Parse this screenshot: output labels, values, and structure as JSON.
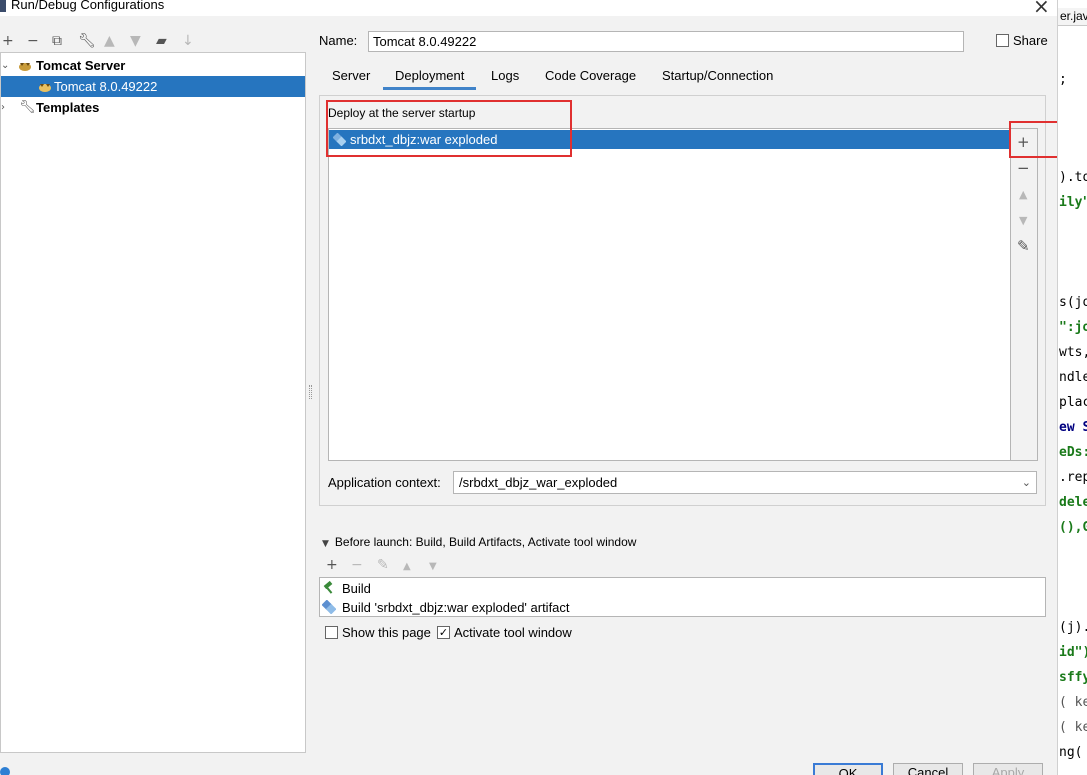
{
  "window": {
    "title": "Run/Debug Configurations"
  },
  "left_toolbar": {
    "icons": [
      "add-icon",
      "remove-icon",
      "copy-icon",
      "wrench-icon",
      "move-up-icon",
      "move-down-icon",
      "folder-icon",
      "sort-icon"
    ]
  },
  "tree": {
    "group_label": "Tomcat Server",
    "child_label": "Tomcat 8.0.49222",
    "templates_label": "Templates"
  },
  "name_field": {
    "label": "Name:",
    "value": "Tomcat 8.0.49222"
  },
  "share": {
    "label": "Share",
    "checked": false
  },
  "tabs": [
    {
      "label": "Server",
      "active": false
    },
    {
      "label": "Deployment",
      "active": true
    },
    {
      "label": "Logs",
      "active": false
    },
    {
      "label": "Code Coverage",
      "active": false
    },
    {
      "label": "Startup/Connection",
      "active": false
    }
  ],
  "deployment": {
    "title": "Deploy at the server startup",
    "items": [
      "srbdxt_dbjz:war exploded"
    ],
    "side_icons": [
      "add-icon",
      "remove-icon",
      "move-up-icon",
      "move-down-icon",
      "edit-icon"
    ]
  },
  "app_context": {
    "label": "Application context:",
    "value": "/srbdxt_dbjz_war_exploded"
  },
  "before_launch": {
    "title": "Before launch: Build, Build Artifacts, Activate tool window",
    "items": [
      "Build",
      "Build 'srbdxt_dbjz:war exploded' artifact"
    ]
  },
  "options": {
    "show_page": {
      "label": "Show this page",
      "checked": false
    },
    "activate_window": {
      "label": "Activate tool window",
      "checked": true
    }
  },
  "buttons": {
    "ok": "OK",
    "cancel": "Cancel",
    "apply": "Apply"
  },
  "editor": {
    "tab": "er.java",
    "lines": [
      {
        "t": ";",
        "c": "#000000"
      },
      {
        "t": ").to",
        "c": "#000000"
      },
      {
        "t": "ily\"",
        "c": "#1a7a1a"
      },
      {
        "t": "s(jo",
        "c": "#000000"
      },
      {
        "t": "\":jo",
        "c": "#1a7a1a"
      },
      {
        "t": "wts,",
        "c": "#000000"
      },
      {
        "t": "ndle",
        "c": "#000000"
      },
      {
        "t": "plac",
        "c": "#000000"
      },
      {
        "t": "ew S",
        "c": "#000080"
      },
      {
        "t": "eDs:",
        "c": "#1a7a1a"
      },
      {
        "t": ".rep",
        "c": "#000000"
      },
      {
        "t": "dele",
        "c": "#1a7a1a"
      },
      {
        "t": "(),G",
        "c": "#1a7a1a"
      },
      {
        "t": "(j).",
        "c": "#000000"
      },
      {
        "t": "id\")",
        "c": "#1a7a1a"
      },
      {
        "t": "sffy",
        "c": "#1a7a1a"
      },
      {
        "t": "( ke",
        "c": "#555555"
      },
      {
        "t": "( ke",
        "c": "#555555"
      },
      {
        "t": "ng(",
        "c": "#000000"
      }
    ]
  },
  "colors": {
    "selection": "#2675bf",
    "highlight": "#e03030",
    "tab_underline": "#4083c9"
  }
}
